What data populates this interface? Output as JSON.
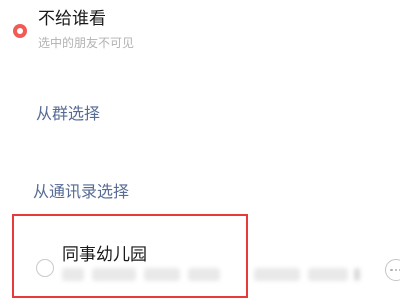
{
  "visibility_options": {
    "dont_show_to": {
      "title": "不给谁看",
      "subtitle": "选中的朋友不可见",
      "selected": true
    }
  },
  "links": {
    "choose_from_group": "从群选择",
    "choose_from_contacts": "从通讯录选择"
  },
  "tag_list": [
    {
      "name": "同事幼儿园",
      "selected": false,
      "members_obscured": true
    }
  ],
  "colors": {
    "accent_red": "#f25a55",
    "link_blue": "#576b95",
    "highlight_border": "#e83a3a"
  },
  "icons": {
    "selected_radio": "radio-checked-icon",
    "unselected_radio": "radio-unchecked-icon",
    "more": "more-options-icon"
  }
}
